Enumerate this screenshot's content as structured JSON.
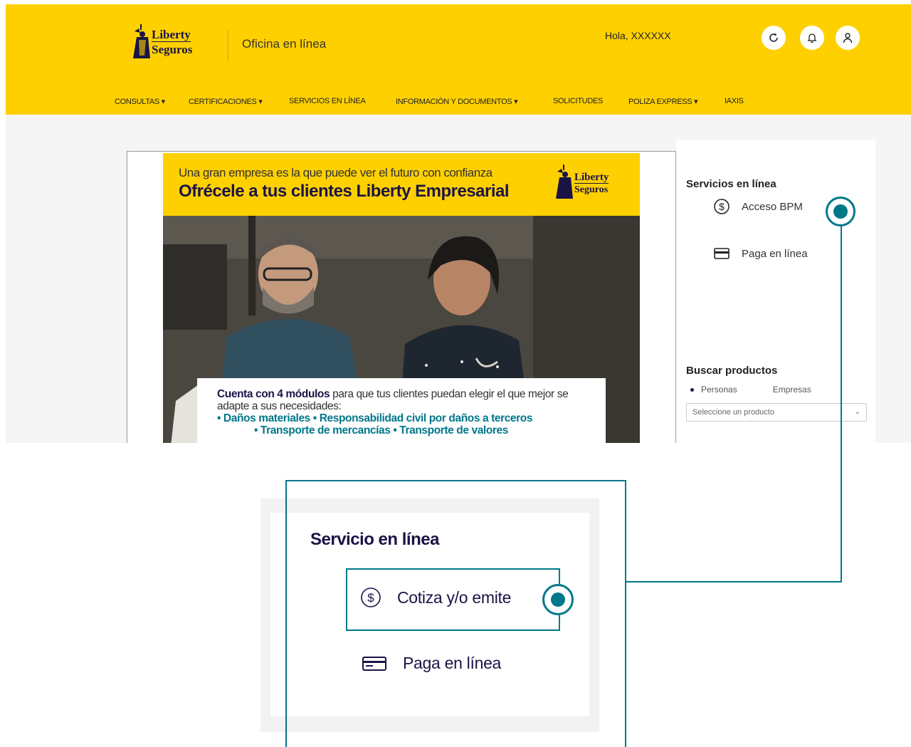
{
  "header": {
    "logo_line1": "Liberty",
    "logo_line2": "Seguros",
    "office_title": "Oficina en línea",
    "greeting": "Hola, XXXXXX"
  },
  "nav": {
    "items": [
      {
        "label": "CONSULTAS ▾"
      },
      {
        "label": "CERTIFICACIONES ▾"
      },
      {
        "label": "SERVICIOS EN LÍNEA"
      },
      {
        "label": "INFORMACIÓN Y DOCUMENTOS ▾"
      },
      {
        "label": "SOLICITUDES"
      },
      {
        "label": "POLIZA EXPRESS ▾"
      },
      {
        "label": "IAXIS"
      }
    ]
  },
  "banner": {
    "tagline": "Una gran empresa es la que puede ver el futuro con confianza",
    "headline": "Ofrécele a tus clientes Liberty Empresarial",
    "logo_line1": "Liberty",
    "logo_line2": "Seguros",
    "card_bold": "Cuenta con 4 módulos",
    "card_text": " para que tus clientes puedan elegir el que mejor se adapte a sus necesidades:",
    "module_line1": "• Daños materiales  • Responsabilidad civil por daños a terceros",
    "module_line2": "• Transporte de mercancías • Transporte de valores"
  },
  "side_panel": {
    "title": "Servicios en línea",
    "bpm_label": "Acceso BPM",
    "pay_label": "Paga en línea",
    "search_title": "Buscar productos",
    "radio_personas": "Personas",
    "radio_empresas": "Empresas",
    "select_placeholder": "Seleccione un producto"
  },
  "zoom_panel": {
    "title": "Servicio en línea",
    "quote_label": "Cotiza y/o emite",
    "pay_label": "Paga en línea"
  },
  "colors": {
    "header_yellow": "#ffd000",
    "navy": "#1a1446",
    "teal": "#00788a"
  }
}
